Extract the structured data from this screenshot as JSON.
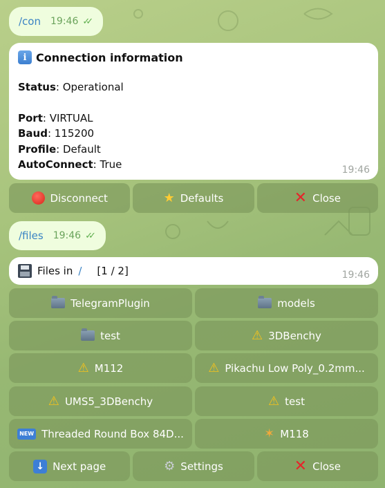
{
  "con_msg": {
    "command": "/con",
    "time": "19:46",
    "ticks": "✓✓"
  },
  "info": {
    "title": "Connection information",
    "icon": "i",
    "status_label": "Status",
    "status_value": ": Operational",
    "port_label": "Port",
    "port_value": ": VIRTUAL",
    "baud_label": "Baud",
    "baud_value": ": 115200",
    "profile_label": "Profile",
    "profile_value": ": Default",
    "autoconnect_label": "AutoConnect",
    "autoconnect_value": ": True",
    "time": "19:46"
  },
  "con_keyboard": [
    {
      "label": "Disconnect",
      "icon": "red-circle-icon"
    },
    {
      "label": "Defaults",
      "icon": "star-icon"
    },
    {
      "label": "Close",
      "icon": "close-icon"
    }
  ],
  "files_msg": {
    "command": "/files",
    "time": "19:46",
    "ticks": "✓✓"
  },
  "files": {
    "title_prefix": "Files in",
    "path": "/",
    "page": "[1 / 2]",
    "time": "19:46",
    "buttons": [
      {
        "label": "TelegramPlugin",
        "icon": "folder-icon"
      },
      {
        "label": "models",
        "icon": "folder-icon"
      },
      {
        "label": "test",
        "icon": "folder-icon"
      },
      {
        "label": "3DBenchy",
        "icon": "warning-icon"
      },
      {
        "label": "M112",
        "icon": "warning-icon"
      },
      {
        "label": "Pikachu Low Poly_0.2mm...",
        "icon": "warning-icon"
      },
      {
        "label": "UMS5_3DBenchy",
        "icon": "warning-icon"
      },
      {
        "label": "test",
        "icon": "warning-icon"
      },
      {
        "label": "Threaded Round Box 84D...",
        "icon": "new-icon"
      },
      {
        "label": "M118",
        "icon": "party-popper-icon"
      }
    ],
    "footer": [
      {
        "label": "Next page",
        "icon": "down-arrow-icon"
      },
      {
        "label": "Settings",
        "icon": "gear-icon"
      },
      {
        "label": "Close",
        "icon": "close-icon"
      }
    ]
  },
  "colors": {
    "bubble": "#effdde",
    "card": "#ffffff",
    "button": "#7a965a",
    "link": "#3a83c4"
  }
}
